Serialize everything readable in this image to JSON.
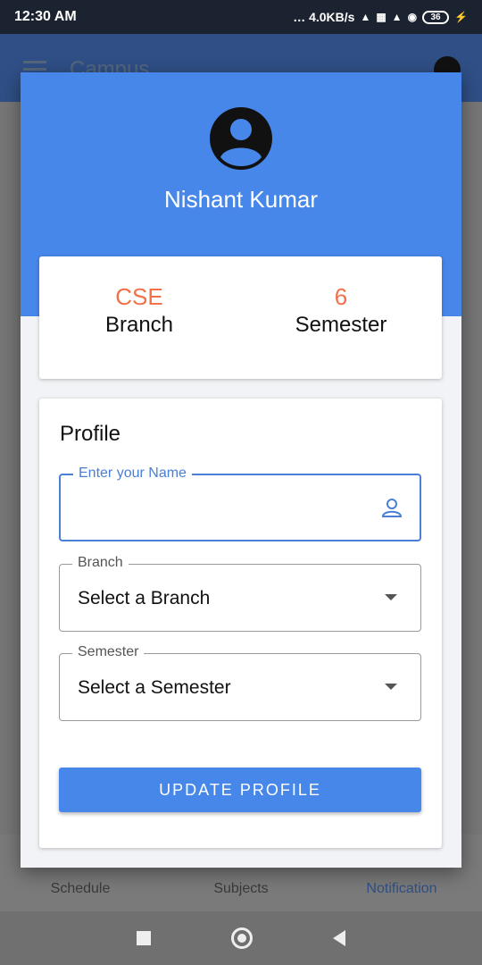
{
  "status_bar": {
    "time": "12:30 AM",
    "network_speed": "… 4.0KB/s",
    "battery": "36",
    "icons": [
      "signal-icon",
      "volte-icon",
      "4g-signal-icon",
      "wifi-icon",
      "battery-icon",
      "charging-icon"
    ]
  },
  "background": {
    "app_title": "Campus",
    "bottom_nav": [
      {
        "label": "Schedule",
        "icon": "calendar-icon"
      },
      {
        "label": "Subjects",
        "icon": "book-icon"
      },
      {
        "label": "Notification",
        "icon": "bell-icon",
        "active": true
      }
    ]
  },
  "dialog": {
    "user_name": "Nishant Kumar",
    "stats": [
      {
        "value": "CSE",
        "label": "Branch"
      },
      {
        "value": "6",
        "label": "Semester"
      }
    ],
    "profile": {
      "title": "Profile",
      "name_field": {
        "label": "Enter your Name",
        "value": ""
      },
      "branch_field": {
        "label": "Branch",
        "value": "Select a Branch"
      },
      "semester_field": {
        "label": "Semester",
        "value": "Select a Semester"
      },
      "update_button": "UPDATE PROFILE"
    }
  },
  "colors": {
    "primary": "#4787ea",
    "accent": "#f2704a",
    "focus": "#4a7fd6"
  }
}
